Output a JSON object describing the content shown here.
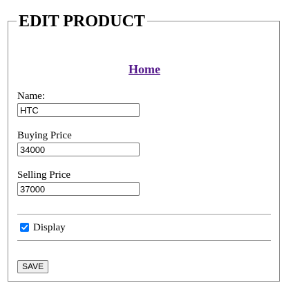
{
  "form": {
    "legend": "EDIT PRODUCT",
    "home_link": "Home",
    "fields": [
      {
        "label": "Name:",
        "value": "HTC"
      },
      {
        "label": "Buying Price",
        "value": "34000"
      },
      {
        "label": "Selling Price",
        "value": "37000"
      }
    ],
    "display_checkbox": {
      "label": "Display",
      "checked": true
    },
    "save_label": "SAVE"
  },
  "colors": {
    "link": "#551a8b",
    "checkbox": "#0075ff",
    "panel_border": "#8a8a8a"
  }
}
